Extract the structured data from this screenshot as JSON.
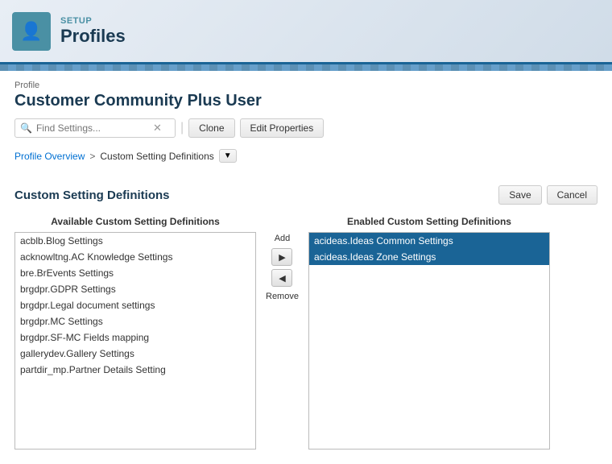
{
  "header": {
    "setup_label": "SETUP",
    "title": "Profiles",
    "icon": "👤"
  },
  "profile": {
    "label": "Profile",
    "name": "Customer Community Plus User"
  },
  "toolbar": {
    "search_placeholder": "Find Settings...",
    "clone_label": "Clone",
    "edit_properties_label": "Edit Properties"
  },
  "breadcrumb": {
    "overview_label": "Profile Overview",
    "separator": ">",
    "current_label": "Custom Setting Definitions"
  },
  "section": {
    "title": "Custom Setting Definitions",
    "save_label": "Save",
    "cancel_label": "Cancel"
  },
  "available_list": {
    "label": "Available Custom Setting Definitions",
    "items": [
      "acblb.Blog Settings",
      "acknowltng.AC Knowledge Settings",
      "bre.BrEvents Settings",
      "brgdpr.GDPR Settings",
      "brgdpr.Legal document settings",
      "brgdpr.MC Settings",
      "brgdpr.SF-MC Fields mapping",
      "gallerydev.Gallery Settings",
      "partdir_mp.Partner Details Setting"
    ]
  },
  "enabled_list": {
    "label": "Enabled Custom Setting Definitions",
    "items": [
      "acideas.Ideas Common Settings",
      "acideas.Ideas Zone Settings"
    ],
    "selected_indices": [
      0,
      1
    ]
  },
  "controls": {
    "add_label": "Add",
    "right_arrow": "▶",
    "left_arrow": "◀",
    "remove_label": "Remove"
  }
}
